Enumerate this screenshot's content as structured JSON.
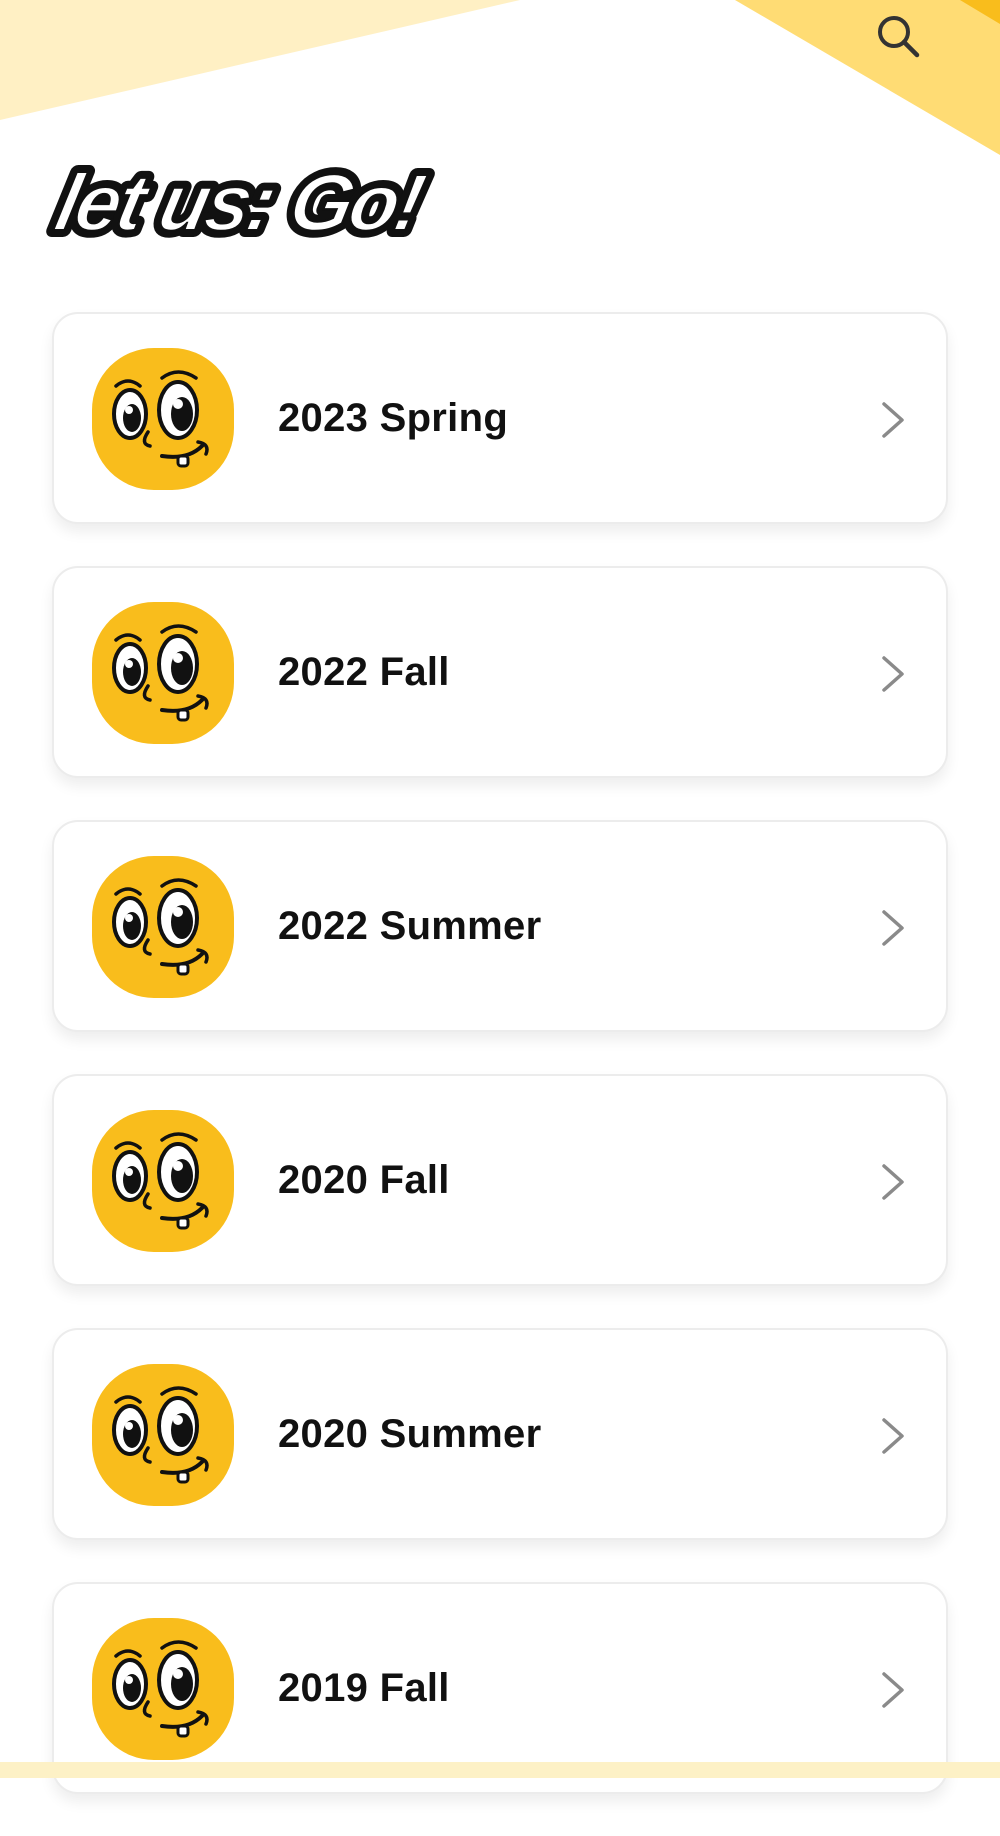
{
  "app": {
    "logo_text": "let us: Go!"
  },
  "header": {
    "search_icon": "search-icon",
    "accent_colors": [
      "#fff0c4",
      "#ffd96e",
      "#f9bd1c"
    ]
  },
  "seasons": [
    {
      "label": "2023 Spring",
      "icon": "duck-face-avatar"
    },
    {
      "label": "2022 Fall",
      "icon": "duck-face-avatar"
    },
    {
      "label": "2022 Summer",
      "icon": "duck-face-avatar"
    },
    {
      "label": "2020 Fall",
      "icon": "duck-face-avatar"
    },
    {
      "label": "2020 Summer",
      "icon": "duck-face-avatar"
    },
    {
      "label": "2019 Fall",
      "icon": "duck-face-avatar"
    }
  ]
}
